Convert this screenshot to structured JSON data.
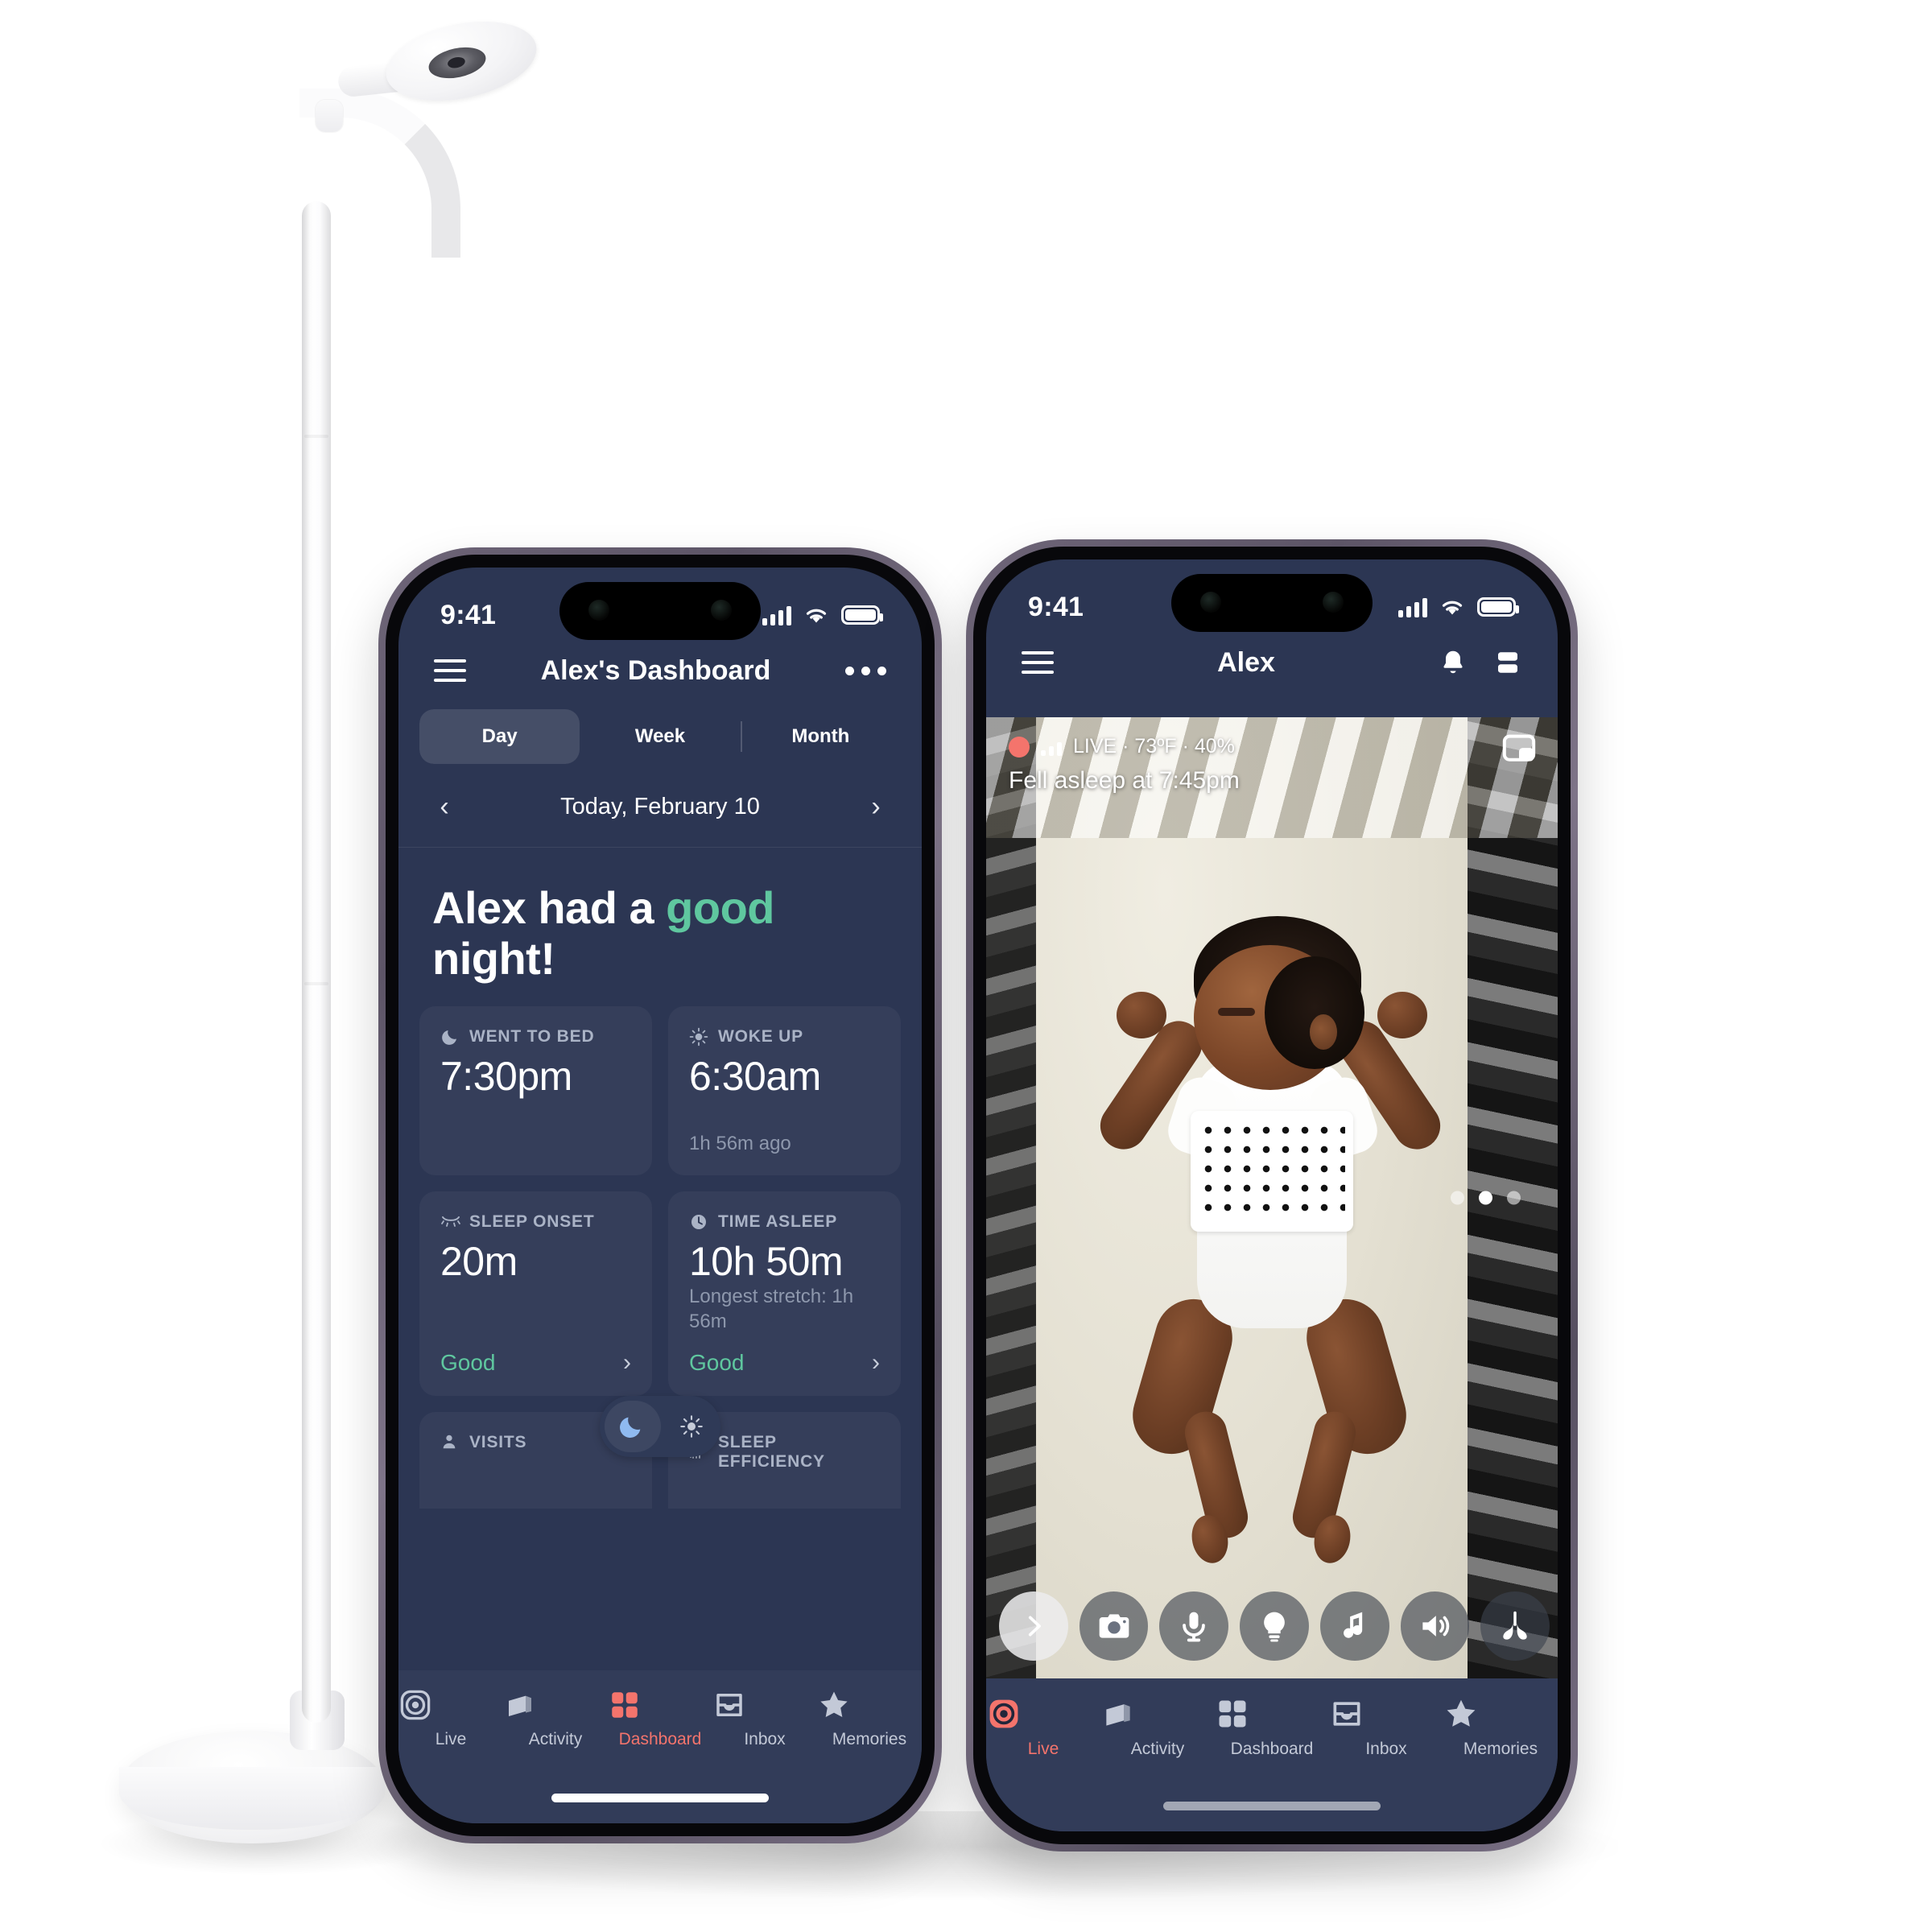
{
  "device": {
    "name": "smart-baby-monitor-floor-stand",
    "color": "#ffffff"
  },
  "theme": {
    "screen_bg": "#2c3653",
    "card_bg": "rgba(255,255,255,0.045)",
    "accent_green": "#5fc79f",
    "accent_red": "#f4746c",
    "tabbar_bg": "#323c59",
    "muted_text": "#aab3c6"
  },
  "dashboard_phone": {
    "status_bar": {
      "time": "9:41",
      "signal_icon": "cellular-signal-icon",
      "wifi_icon": "wifi-icon",
      "battery_icon": "battery-icon"
    },
    "header": {
      "menu_icon": "hamburger-menu-icon",
      "title": "Alex's Dashboard",
      "more_icon": "more-options-icon"
    },
    "segmented_control": {
      "options": [
        "Day",
        "Week",
        "Month"
      ],
      "selected": "Day"
    },
    "date_nav": {
      "prev_icon": "chevron-left-icon",
      "label": "Today, February 10",
      "next_icon": "chevron-right-icon"
    },
    "headline": {
      "prefix": "Alex had a ",
      "highlight": "good",
      "suffix": " night!"
    },
    "cards": [
      {
        "icon": "moon-icon",
        "label": "WENT TO BED",
        "value": "7:30pm",
        "sub": "",
        "status": "",
        "chevron": ""
      },
      {
        "icon": "sun-icon",
        "label": "WOKE UP",
        "value": "6:30am",
        "sub": "1h 56m ago",
        "status": "",
        "chevron": ""
      },
      {
        "icon": "closed-eye-icon",
        "label": "SLEEP ONSET",
        "value": "20m",
        "sub": "",
        "status": "Good",
        "chevron": "›"
      },
      {
        "icon": "clock-icon",
        "label": "TIME ASLEEP",
        "value": "10h 50m",
        "sub": "Longest stretch: 1h 56m",
        "status": "Good",
        "chevron": "›"
      }
    ],
    "bottom_cards": [
      {
        "icon": "person-icon",
        "label": "VISITS"
      },
      {
        "icon": "efficiency-icon",
        "label": "SLEEP EFFICIENCY"
      }
    ],
    "day_night_toggle": {
      "night_icon": "moon-icon",
      "day_icon": "sun-icon",
      "selected": "night"
    },
    "tab_bar": {
      "items": [
        {
          "icon": "live-target-icon",
          "label": "Live",
          "active": false
        },
        {
          "icon": "activity-card-icon",
          "label": "Activity",
          "active": false
        },
        {
          "icon": "dashboard-grid-icon",
          "label": "Dashboard",
          "active": true
        },
        {
          "icon": "inbox-tray-icon",
          "label": "Inbox",
          "active": false
        },
        {
          "icon": "memories-star-icon",
          "label": "Memories",
          "active": false
        }
      ]
    }
  },
  "live_phone": {
    "status_bar": {
      "time": "9:41",
      "signal_icon": "cellular-signal-icon",
      "wifi_icon": "wifi-icon",
      "battery_icon": "battery-icon"
    },
    "header": {
      "menu_icon": "hamburger-menu-icon",
      "title": "Alex",
      "bell_icon": "notification-bell-icon",
      "layout_icon": "split-layout-icon"
    },
    "live_overlay": {
      "rec_indicator": "recording-dot-icon",
      "signal_icon": "stream-signal-icon",
      "status_text": "LIVE · ",
      "temperature_icon": "thermometer-icon",
      "temperature": "73ºF",
      "separator": " · ",
      "humidity_icon": "humidity-drop-icon",
      "humidity": "40%",
      "full_status": "LIVE · 73ºF · 40%",
      "sleep_note": "Fell asleep at 7:45pm",
      "pip_icon": "picture-in-picture-icon"
    },
    "carousel": {
      "total": 3,
      "active_index": 1
    },
    "controls": [
      {
        "icon": "expand-chevron-icon",
        "name": "expand-controls-button"
      },
      {
        "icon": "camera-icon",
        "name": "camera-button"
      },
      {
        "icon": "microphone-icon",
        "name": "talk-button"
      },
      {
        "icon": "lightbulb-icon",
        "name": "nightlight-button"
      },
      {
        "icon": "music-note-icon",
        "name": "sound-machine-button"
      },
      {
        "icon": "speaker-icon",
        "name": "volume-button"
      },
      {
        "icon": "lungs-icon",
        "name": "breathing-button"
      }
    ],
    "tab_bar": {
      "items": [
        {
          "icon": "live-target-icon",
          "label": "Live",
          "active": true
        },
        {
          "icon": "activity-card-icon",
          "label": "Activity",
          "active": false
        },
        {
          "icon": "dashboard-grid-icon",
          "label": "Dashboard",
          "active": false
        },
        {
          "icon": "inbox-tray-icon",
          "label": "Inbox",
          "active": false
        },
        {
          "icon": "memories-star-icon",
          "label": "Memories",
          "active": false
        }
      ]
    }
  }
}
